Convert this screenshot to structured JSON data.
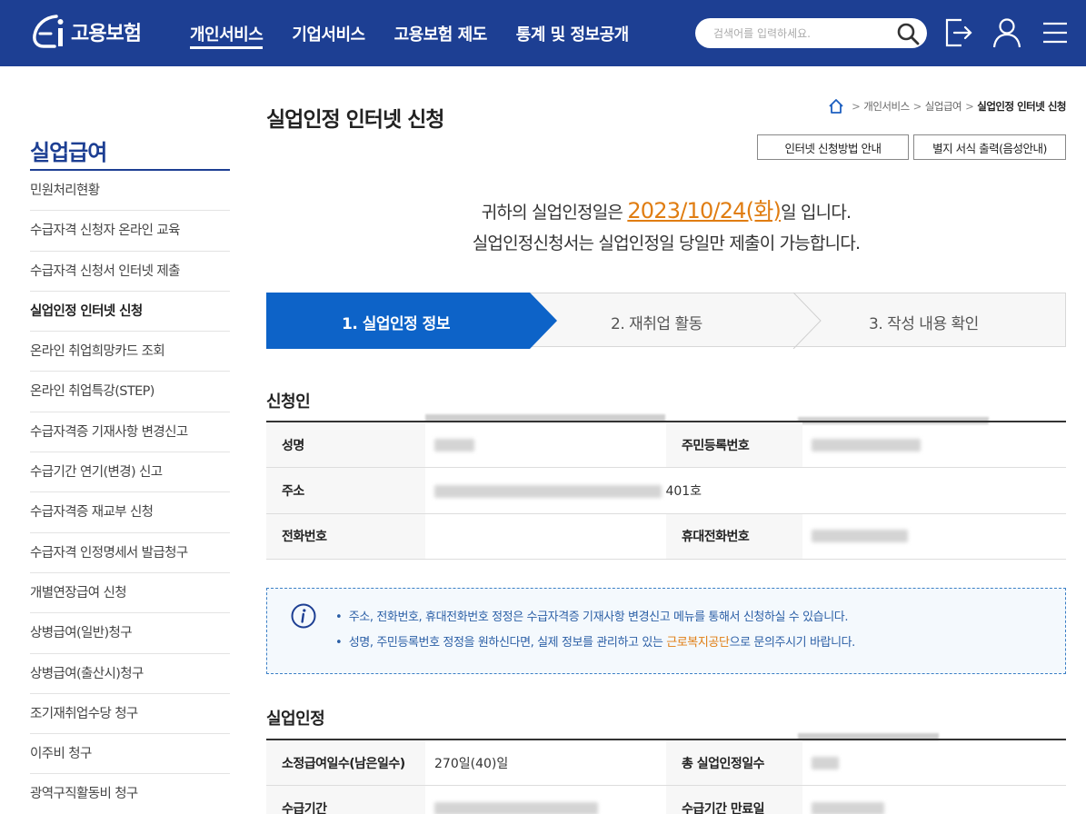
{
  "header": {
    "logo_text": "고용보험",
    "nav": [
      {
        "label": "개인서비스",
        "active": true
      },
      {
        "label": "기업서비스",
        "active": false
      },
      {
        "label": "고용보험 제도",
        "active": false
      },
      {
        "label": "통계 및 정보공개",
        "active": false
      }
    ],
    "search_placeholder": "검색어를 입력하세요.",
    "icons": [
      "search-icon",
      "logout-icon",
      "user-icon",
      "menu-icon"
    ]
  },
  "sidebar": {
    "title": "실업급여",
    "items": [
      {
        "label": "민원처리현황"
      },
      {
        "label": "수급자격 신청자 온라인 교육"
      },
      {
        "label": "수급자격 신청서 인터넷 제출"
      },
      {
        "label": "실업인정 인터넷 신청",
        "active": true
      },
      {
        "label": "온라인 취업희망카드 조회"
      },
      {
        "label": "온라인 취업특강(STEP)"
      },
      {
        "label": "수급자격증 기재사항 변경신고"
      },
      {
        "label": "수급기간 연기(변경) 신고"
      },
      {
        "label": "수급자격증 재교부 신청"
      },
      {
        "label": "수급자격 인정명세서 발급청구"
      },
      {
        "label": "개별연장급여 신청"
      },
      {
        "label": "상병급여(일반)청구"
      },
      {
        "label": "상병급여(출산시)청구"
      },
      {
        "label": "조기재취업수당 청구"
      },
      {
        "label": "이주비 청구"
      },
      {
        "label": "광역구직활동비 청구"
      }
    ]
  },
  "main": {
    "title": "실업인정 인터넷 신청",
    "breadcrumb": [
      "개인서비스",
      "실업급여",
      "실업인정 인터넷 신청"
    ],
    "buttons": {
      "guide": "인터넷 신청방법 안내",
      "print": "별지 서식 출력(음성안내)"
    },
    "notice": {
      "line1_pre": "귀하의 실업인정일은 ",
      "date": "2023/10/24(화)",
      "line1_post": "일 입니다.",
      "line2": "실업인정신청서는 실업인정일 당일만 제출이 가능합니다."
    },
    "steps": [
      {
        "label": "1. 실업인정 정보",
        "active": true
      },
      {
        "label": "2. 재취업 활동",
        "active": false
      },
      {
        "label": "3. 작성 내용 확인",
        "active": false
      }
    ],
    "applicant": {
      "title": "신청인",
      "name_label": "성명",
      "rrn_label": "주민등록번호",
      "address_label": "주소",
      "address_suffix": "401호",
      "phone_label": "전화번호",
      "mobile_label": "휴대전화번호"
    },
    "info": {
      "line1": "주소, 전화번호, 휴대전화번호 정정은 수급자격증 기재사항 변경신고 메뉴를 통해서 신청하실 수 있습니다.",
      "line2_pre": "성명, 주민등록번호 정정을 원하신다면, 실제 정보를 관리하고 있는 ",
      "line2_hl": "근로복지공단",
      "line2_post": "으로 문의주시기 바랍니다."
    },
    "unemployment": {
      "title": "실업인정",
      "days_label": "소정급여일수(남은일수)",
      "days_value": "270일(40)일",
      "total_label": "총 실업인정일수",
      "period_label": "수급기간",
      "expiry_label": "수급기간 만료일"
    }
  },
  "colors": {
    "header_bg": "#1d3f93",
    "accent_blue": "#0d63c8",
    "accent_orange": "#e07d12"
  }
}
